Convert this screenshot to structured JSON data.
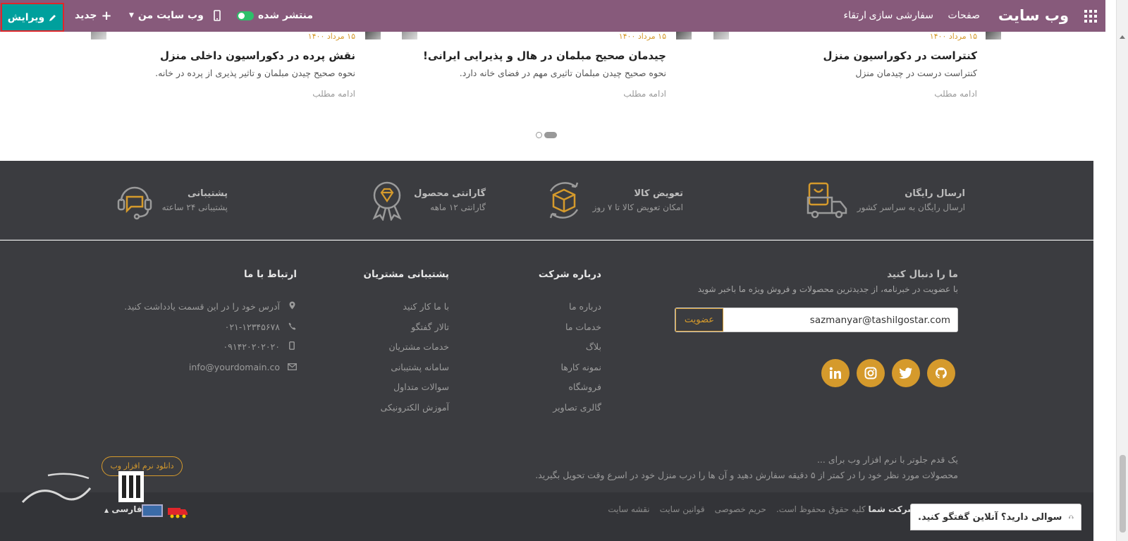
{
  "topbar": {
    "brand": "وب سایت",
    "menu": [
      "صفحات",
      "سفارشی سازی",
      "ارتقاء"
    ],
    "published_label": "منتشر شده",
    "mysite_label": "وب سایت من",
    "new_label": "جدید",
    "edit_label": "ویرایش"
  },
  "blog": {
    "posts": [
      {
        "date": "۱۵ مرداد ۱۴۰۰",
        "title": "کنتراست در دکوراسیون منزل",
        "excerpt": "کنتراست درست در چیدمان منزل",
        "more": "ادامه مطلب"
      },
      {
        "date": "۱۵ مرداد ۱۴۰۰",
        "title": "چیدمان صحیح مبلمان در هال و پذیرایی ایرانی!",
        "excerpt": "نحوه صحیح چیدن مبلمان تاثیری مهم در فضای خانه دارد.",
        "more": "ادامه مطلب"
      },
      {
        "date": "۱۵ مرداد ۱۴۰۰",
        "title": "نقش پرده در دکوراسیون داخلی منزل",
        "excerpt": "نحوه صحیح چیدن مبلمان و تاثیر پذیری از پرده در خانه.",
        "more": "ادامه مطلب"
      }
    ]
  },
  "features": [
    {
      "title": "ارسال رایگان",
      "sub": "ارسال رایگان به سراسر کشور",
      "icon": "delivery-truck-icon"
    },
    {
      "title": "تعویض کالا",
      "sub": "امکان تعویض کالا تا ۷ روز",
      "icon": "box-return-icon"
    },
    {
      "title": "گارانتی محصول",
      "sub": "گارانتی ۱۲ ماهه",
      "icon": "warranty-badge-icon"
    },
    {
      "title": "پشتیبانی",
      "sub": "پشتیبانی ۲۴ ساعته",
      "icon": "headset-icon"
    }
  ],
  "footer": {
    "follow": {
      "title": "ما را دنبال کنید",
      "desc": "با عضویت در خبرنامه، از جدیدترین محصولات و فروش ویژه ما باخبر شوید",
      "email_value": "sazmanyar@tashilgostar.com",
      "subscribe_label": "عضویت"
    },
    "about": {
      "title": "درباره شرکت",
      "links": [
        "درباره ما",
        "خدمات ما",
        "بلاگ",
        "نمونه کارها",
        "فروشگاه",
        "گالری تصاویر"
      ]
    },
    "support": {
      "title": "پشتیبانی مشتریان",
      "links": [
        "با ما کار کنید",
        "تالار گفتگو",
        "خدمات مشتریان",
        "سامانه پشتیبانی",
        "سوالات متداول",
        "آموزش الکترونیکی"
      ]
    },
    "contact": {
      "title": "ارتباط با ما",
      "address": "آدرس خود را در این قسمت یادداشت کنید.",
      "phone": "۰۲۱-۱۲۳۴۵۶۷۸",
      "mobile": "۰۹۱۴۲۰۲۰۲۰۲۰",
      "email": "info@yourdomain.co"
    },
    "tagline_1": "یک قدم جلوتر با نرم افزار وب برای ...",
    "tagline_2": "محصولات مورد نظر خود را در کمتر از ۵ دقیقه سفارش دهید و آن ها را درب منزل خود در اسرع وقت تحویل بگیرید.",
    "download_label": "دانلود نرم افزار وب"
  },
  "bottom": {
    "company": "نام شرکت شما",
    "rights": "کلیه حقوق محفوظ است.",
    "links": [
      "حریم خصوصی",
      "قوانین سایت",
      "نقشه سایت"
    ],
    "language": "فارسی",
    "chat_label": "سوالی دارید؟ آنلاین گفتگو کنید."
  },
  "colors": {
    "topbar": "#875a7b",
    "edit_button": "#00a09d",
    "accent": "#d59a2c",
    "footer_bg": "#3b3c40"
  }
}
